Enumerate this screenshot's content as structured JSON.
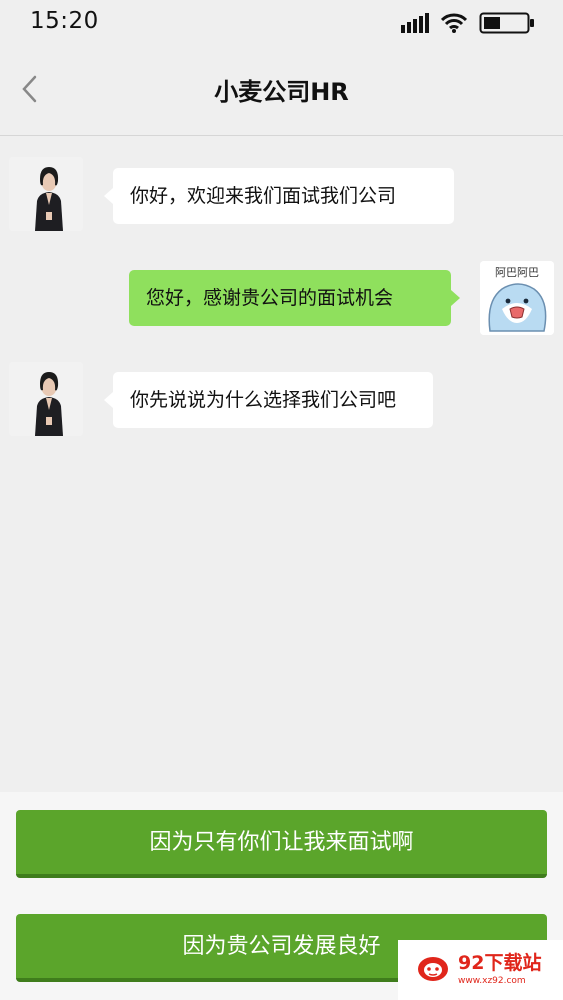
{
  "status_bar": {
    "time": "15:20"
  },
  "nav": {
    "title": "小麦公司HR"
  },
  "messages": [
    {
      "side": "left",
      "sender": "hr",
      "text": "你好，欢迎来我们面试我们公司"
    },
    {
      "side": "right",
      "sender": "me",
      "text": "您好，感谢贵公司的面试机会"
    },
    {
      "side": "left",
      "sender": "hr",
      "text": "你先说说为什么选择我们公司吧"
    }
  ],
  "avatar_me_caption": "阿巴阿巴",
  "options": [
    {
      "label": "因为只有你们让我来面试啊"
    },
    {
      "label": "因为贵公司发展良好"
    }
  ],
  "watermark": {
    "name": "92下载站",
    "url": "www.xz92.com"
  },
  "colors": {
    "background": "#efefef",
    "bubble_left": "#ffffff",
    "bubble_right": "#8fe05d",
    "option_button": "#5ba52b",
    "watermark": "#e0261b"
  }
}
